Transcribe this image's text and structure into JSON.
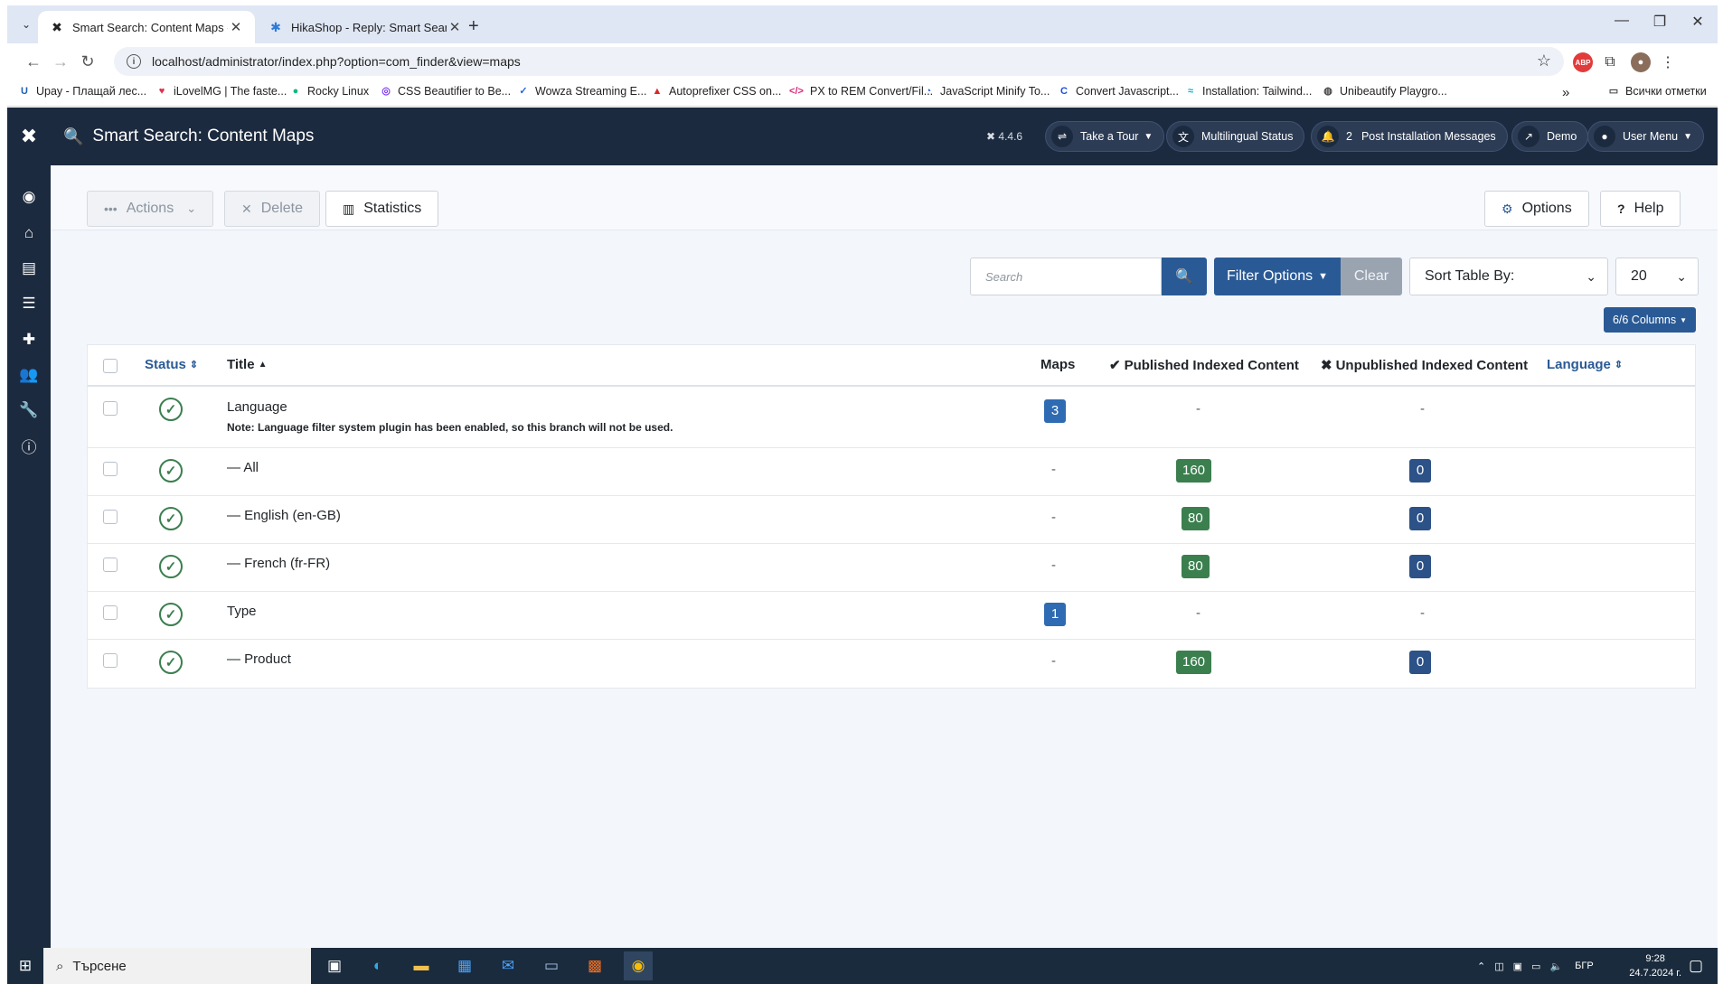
{
  "browser": {
    "tabs": [
      {
        "title": "Smart Search: Content Maps - [",
        "active": true
      },
      {
        "title": "HikaShop - Reply: Smart Search",
        "active": false
      }
    ],
    "url": "localhost/administrator/index.php?option=com_finder&view=maps",
    "bookmarks": [
      "Upay - Плащай лес...",
      "iLovelMG | The faste...",
      "Rocky Linux",
      "CSS Beautifier to Be...",
      "Wowza Streaming E...",
      "Autoprefixer CSS on...",
      "PX to REM Convert/Fil...",
      "JavaScript Minify To...",
      "Convert Javascript...",
      "Installation: Tailwind...",
      "Unibeautify Playgro..."
    ],
    "bookmarks_more": "»",
    "all_bookmarks": "Всички отметки"
  },
  "header": {
    "title": "Smart Search: Content Maps",
    "version": "4.4.6",
    "take_tour": "Take a Tour",
    "multilingual_status": "Multilingual Status",
    "post_install_count": "2",
    "post_install_messages": "Post Installation Messages",
    "demo": "Demo",
    "user_menu": "User Menu"
  },
  "toolbar": {
    "actions": "Actions",
    "delete": "Delete",
    "statistics": "Statistics",
    "options": "Options",
    "help": "Help"
  },
  "filters": {
    "search_placeholder": "Search",
    "filter_options": "Filter Options",
    "clear": "Clear",
    "sort_by": "Sort Table By:",
    "limit": "20",
    "columns": "6/6 Columns"
  },
  "table": {
    "headers": {
      "status": "Status",
      "title": "Title",
      "maps": "Maps",
      "published": "Published Indexed Content",
      "unpublished": "Unpublished Indexed Content",
      "language": "Language"
    },
    "rows": [
      {
        "title": "Language",
        "note": "Note: Language filter system plugin has been enabled, so this branch will not be used.",
        "maps": "3",
        "published": "-",
        "unpublished": "-"
      },
      {
        "title": "— All",
        "note": "",
        "maps": "-",
        "published": "160",
        "unpublished": "0"
      },
      {
        "title": "— English (en-GB)",
        "note": "",
        "maps": "-",
        "published": "80",
        "unpublished": "0"
      },
      {
        "title": "— French (fr-FR)",
        "note": "",
        "maps": "-",
        "published": "80",
        "unpublished": "0"
      },
      {
        "title": "Type",
        "note": "",
        "maps": "1",
        "published": "-",
        "unpublished": "-"
      },
      {
        "title": "— Product",
        "note": "",
        "maps": "-",
        "published": "160",
        "unpublished": "0"
      }
    ]
  },
  "taskbar": {
    "search": "Търсене",
    "lang": "БГР",
    "time": "9:28",
    "date": "24.7.2024 г."
  },
  "colors": {
    "header_bg": "#1c2a3f",
    "primary": "#2a5a95",
    "success": "#3b7f4f",
    "badge_blue": "#2e6bb3"
  }
}
